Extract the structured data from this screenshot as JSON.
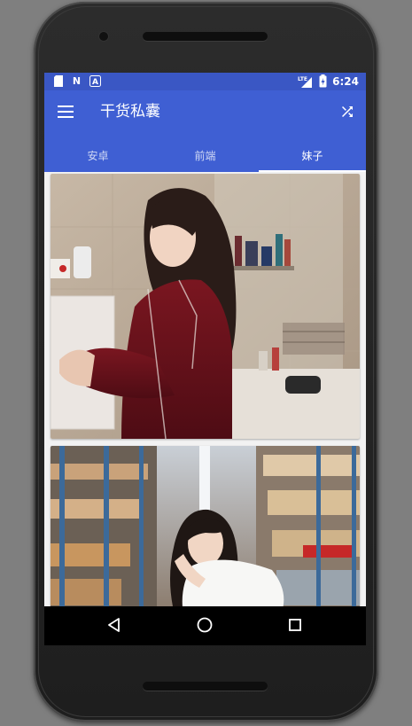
{
  "status_bar": {
    "time": "6:24",
    "left_icons": [
      "sd-card-icon",
      "n-notification-icon",
      "a-notification-icon"
    ],
    "network": "LTE",
    "battery_icon": "battery-charging-icon"
  },
  "app_bar": {
    "title": "干货私囊",
    "menu_icon": "hamburger-menu-icon",
    "action_icon": "shuffle-icon",
    "color": "#3f5fd3"
  },
  "tabs": [
    {
      "label": "安卓",
      "active": false
    },
    {
      "label": "前端",
      "active": false
    },
    {
      "label": "妹子",
      "active": true
    }
  ],
  "feed": {
    "items": [
      {
        "type": "photo",
        "subject": "girl in red pajamas in bathroom"
      },
      {
        "type": "photo",
        "subject": "girl crouching in warehouse aisle"
      }
    ]
  },
  "nav_bar": {
    "back": "back-triangle-icon",
    "home": "home-circle-icon",
    "recents": "recents-square-icon"
  },
  "colors": {
    "status_bar": "#3a57c4",
    "primary": "#3f5fd3",
    "accent": "#ffffff"
  }
}
